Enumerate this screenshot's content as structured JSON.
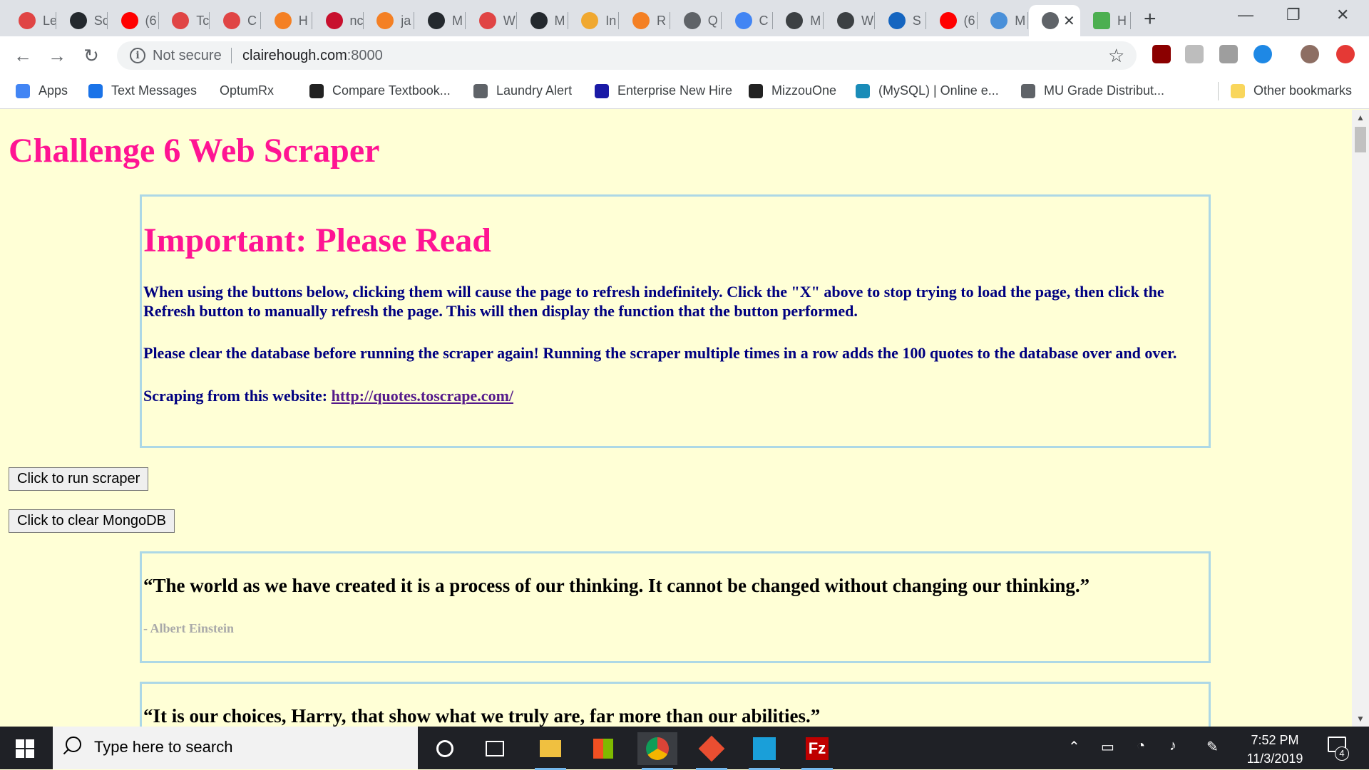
{
  "browser": {
    "tabs": [
      {
        "label": "Le",
        "icon": "gear-red-icon",
        "color": "#e04545"
      },
      {
        "label": "Sc",
        "icon": "github-icon",
        "color": "#24292e"
      },
      {
        "label": "(6",
        "icon": "youtube-icon",
        "color": "#ff0000"
      },
      {
        "label": "Tc",
        "icon": "gear-red-icon",
        "color": "#e04545"
      },
      {
        "label": "C",
        "icon": "gear-red-icon",
        "color": "#e04545"
      },
      {
        "label": "H",
        "icon": "stackoverflow-icon",
        "color": "#f48024"
      },
      {
        "label": "nc",
        "icon": "n-red-icon",
        "color": "#c8102e"
      },
      {
        "label": "ja",
        "icon": "stackoverflow-icon",
        "color": "#f48024"
      },
      {
        "label": "M",
        "icon": "github-icon",
        "color": "#24292e"
      },
      {
        "label": "W",
        "icon": "gear-red-icon",
        "color": "#e04545"
      },
      {
        "label": "M",
        "icon": "github-icon",
        "color": "#24292e"
      },
      {
        "label": "In",
        "icon": "box-icon",
        "color": "#f0a830"
      },
      {
        "label": "R",
        "icon": "stackoverflow-icon",
        "color": "#f48024"
      },
      {
        "label": "Q",
        "icon": "globe-icon",
        "color": "#5f6368"
      },
      {
        "label": "C",
        "icon": "docs-icon",
        "color": "#4285f4"
      },
      {
        "label": "M",
        "icon": "diamond-icon",
        "color": "#3c4043"
      },
      {
        "label": "W",
        "icon": "python-icon",
        "color": "#3c4043"
      },
      {
        "label": "S",
        "icon": "siv-icon",
        "color": "#1565c0"
      },
      {
        "label": "(6",
        "icon": "youtube-icon",
        "color": "#ff0000"
      },
      {
        "label": "M",
        "icon": "kaggle-icon",
        "color": "#4a90d9"
      }
    ],
    "active_tab": {
      "icon": "globe-icon",
      "close": "✕"
    },
    "last_tab": {
      "label": "H",
      "icon": "w3-icon",
      "color": "#4caf50"
    },
    "new_tab": "+",
    "window": {
      "minimize": "—",
      "restore": "❐",
      "close": "✕"
    },
    "nav": {
      "back": "←",
      "forward": "→",
      "reload": "↻"
    },
    "omnibox": {
      "security": "Not secure",
      "host": "clairehough.com",
      "port": ":8000",
      "star": "☆"
    },
    "bookmarks": [
      {
        "label": "Apps",
        "icon": "apps-grid-icon",
        "color": "#4285f4"
      },
      {
        "label": "Text Messages",
        "icon": "messages-icon",
        "color": "#1a73e8"
      },
      {
        "label": "OptumRx",
        "icon": "",
        "color": ""
      },
      {
        "label": "Compare Textbook...",
        "icon": "mizzou-icon",
        "color": "#222222"
      },
      {
        "label": "Laundry Alert",
        "icon": "globe-icon",
        "color": "#5f6368"
      },
      {
        "label": "Enterprise New Hire",
        "icon": "info-i-icon",
        "color": "#1a1aa6"
      },
      {
        "label": "MizzouOne",
        "icon": "mizzou-icon",
        "color": "#222222"
      },
      {
        "label": "(MySQL) | Online e...",
        "icon": "mysql-icon",
        "color": "#1a8cb8"
      },
      {
        "label": "MU Grade Distribut...",
        "icon": "globe-icon",
        "color": "#5f6368"
      }
    ],
    "other_bookmarks": "Other bookmarks"
  },
  "page": {
    "title": "Challenge 6 Web Scraper",
    "notice": {
      "heading": "Important: Please Read",
      "para1": "When using the buttons below, clicking them will cause the page to refresh indefinitely. Click the \"X\" above to stop trying to load the page, then click the Refresh button to manually refresh the page. This will then display the function that the button performed.",
      "para2": "Please clear the database before running the scraper again! Running the scraper multiple times in a row adds the 100 quotes to the database over and over.",
      "source_prefix": "Scraping from this website: ",
      "source_link": "http://quotes.toscrape.com/"
    },
    "buttons": {
      "run": "Click to run scraper",
      "clear": "Click to clear MongoDB"
    },
    "quotes": [
      {
        "text": "“The world as we have created it is a process of our thinking. It cannot be changed without changing our thinking.”",
        "author": "- Albert Einstein"
      },
      {
        "text": "“It is our choices, Harry, that show what we truly are, far more than our abilities.”",
        "author": ""
      }
    ],
    "colors": {
      "title": "#ff1493",
      "body_text": "#000080",
      "background": "#ffffd6",
      "box_border": "#add8e6"
    }
  },
  "taskbar": {
    "search_placeholder": "Type here to search",
    "time": "7:52 PM",
    "date": "11/3/2019",
    "notifications": "4",
    "apps": [
      {
        "name": "cortana-icon"
      },
      {
        "name": "task-view-icon"
      },
      {
        "name": "file-explorer-icon",
        "color": "#f0c040"
      },
      {
        "name": "microsoft-store-icon",
        "color": "#ffffff"
      },
      {
        "name": "chrome-icon",
        "color": "#4285f4"
      },
      {
        "name": "git-icon",
        "color": "#e94e31"
      },
      {
        "name": "bracket-app-icon",
        "color": "#1a9fd9"
      },
      {
        "name": "filezilla-icon",
        "color": "#bf0000"
      }
    ]
  }
}
